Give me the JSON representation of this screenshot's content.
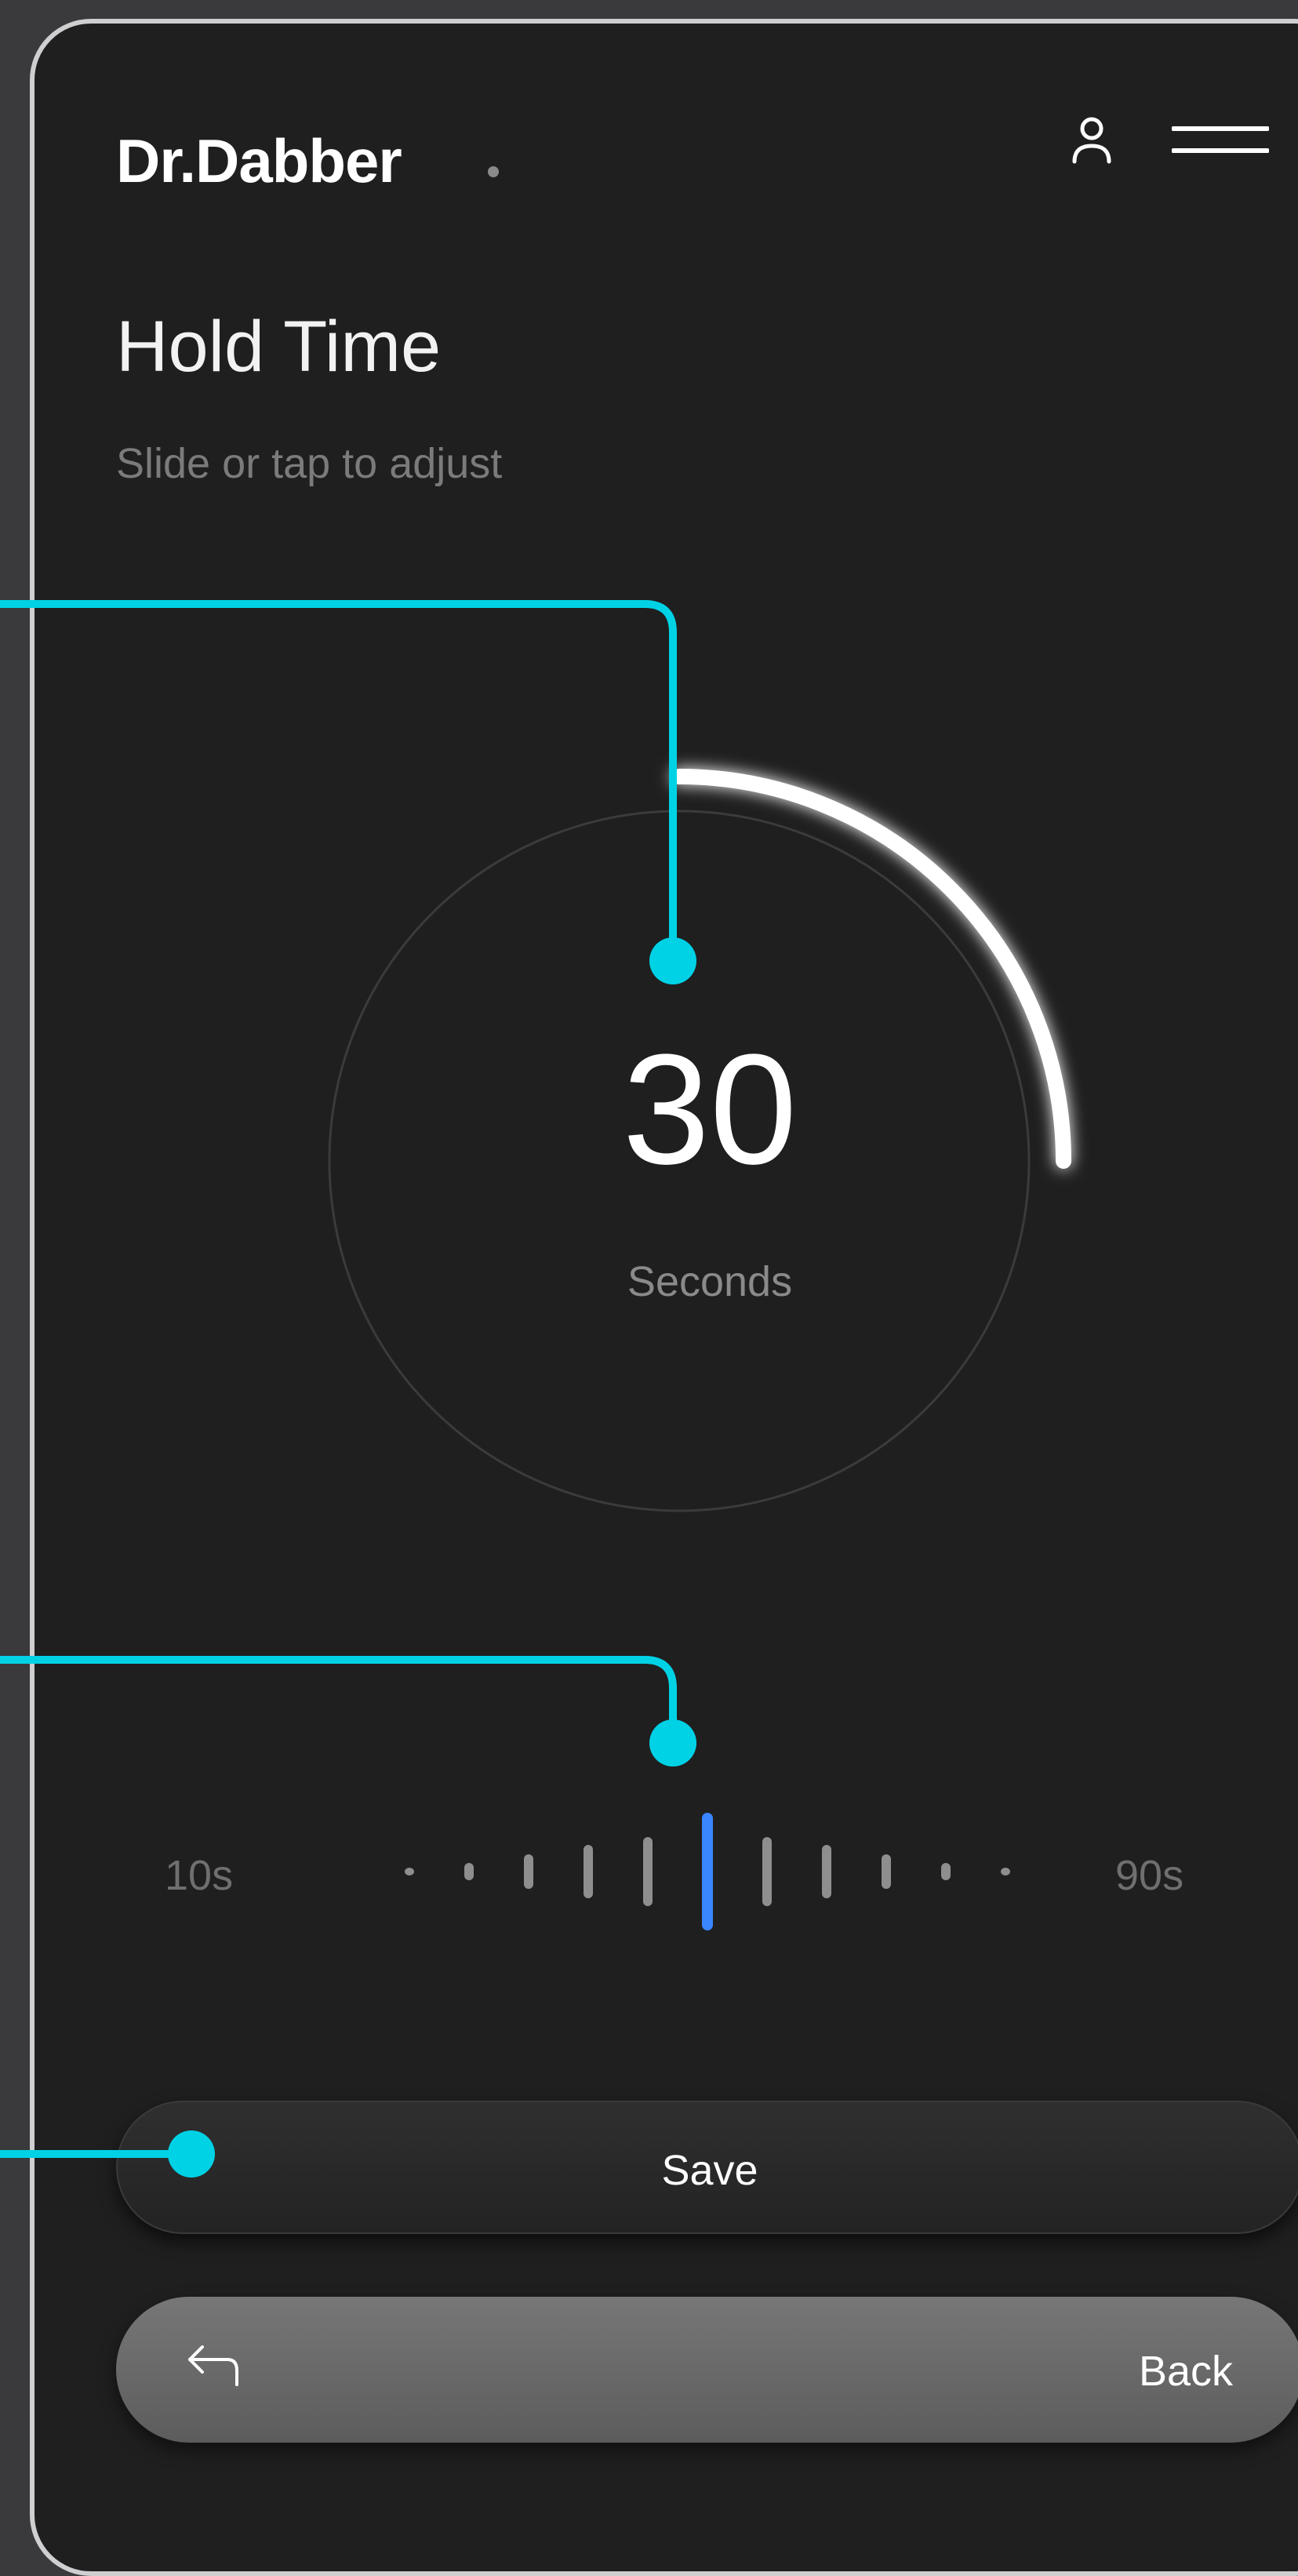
{
  "header": {
    "brand": "Dr.Dabber",
    "user_icon": "user-icon",
    "menu_icon": "hamburger-menu-icon"
  },
  "page": {
    "title": "Hold Time",
    "subtitle": "Slide or tap to adjust"
  },
  "dial": {
    "value": "30",
    "unit": "Seconds",
    "progress_fraction": 0.25
  },
  "scale": {
    "min_label": "10s",
    "max_label": "90s",
    "selected_index": 5,
    "tick_count": 11
  },
  "actions": {
    "save_label": "Save",
    "back_label": "Back",
    "back_icon": "back-arrow-icon"
  },
  "colors": {
    "background": "#1f1f1f",
    "accent_callout": "#00d2e6",
    "selected_tick": "#3a86ff",
    "arc": "#ffffff"
  }
}
